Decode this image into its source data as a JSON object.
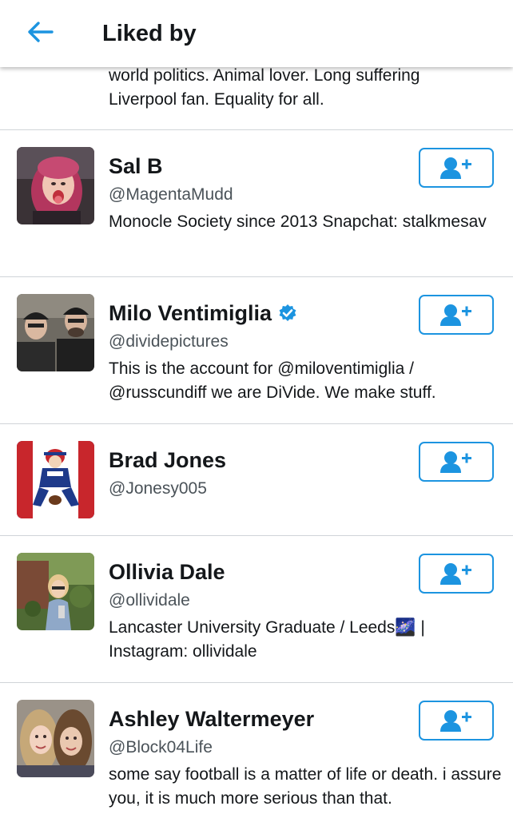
{
  "header": {
    "title": "Liked by",
    "back_icon": "arrow-left-icon"
  },
  "colors": {
    "accent": "#1c94e0",
    "text": "#14171a",
    "secondary_text": "#4b5359",
    "divider": "#d0d4d8"
  },
  "partial_item": {
    "bio": "world politics. Animal lover. Long suffering\nLiverpool fan. Equality for all."
  },
  "users": [
    {
      "name": "Sal B",
      "handle": "@MagentaMudd",
      "bio": "Monocle Society since 2013 Snapchat: stalkmesav",
      "verified": false,
      "follow_icon": "add-user-icon"
    },
    {
      "name": "Milo Ventimiglia",
      "handle": "@dividepictures",
      "bio": "This is the account for @miloventimiglia / @russcundiff we are DiVide. We make stuff.",
      "verified": true,
      "follow_icon": "add-user-icon"
    },
    {
      "name": "Brad Jones",
      "handle": "@Jonesy005",
      "bio": "",
      "verified": false,
      "follow_icon": "add-user-icon"
    },
    {
      "name": "Ollivia Dale",
      "handle": "@ollividale",
      "bio": "Lancaster University Graduate / Leeds🌌 | Instagram: ollividale",
      "verified": false,
      "follow_icon": "add-user-icon"
    },
    {
      "name": "Ashley Waltermeyer",
      "handle": "@Block04Life",
      "bio": "some say football is a matter of life or death. i assure you, it is much more serious than that.",
      "verified": false,
      "follow_icon": "add-user-icon"
    }
  ]
}
